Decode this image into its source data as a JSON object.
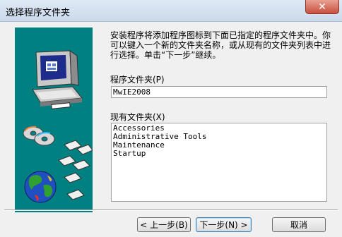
{
  "window": {
    "title": "选择程序文件夹",
    "close_glyph": "✕"
  },
  "description": "安装程序将添加程序图标到下面已指定的程序文件夹中。你可以键入一个新的文件夹名称，或从现有的文件夹列表中进行选择。单击“下一步”继续。",
  "program_folder": {
    "label": "程序文件夹(P)",
    "value": "MwIE2008"
  },
  "existing_folders": {
    "label": "现有文件夹(X)",
    "items": [
      "Accessories",
      "Administrative Tools",
      "Maintenance",
      "Startup"
    ]
  },
  "buttons": {
    "back": "< 上一步(B)",
    "next": "下一步(N) >",
    "cancel": "取消"
  },
  "colors": {
    "art_background": "#008080",
    "title_bar": "#dfe9f5",
    "close_button": "#c7503c"
  }
}
